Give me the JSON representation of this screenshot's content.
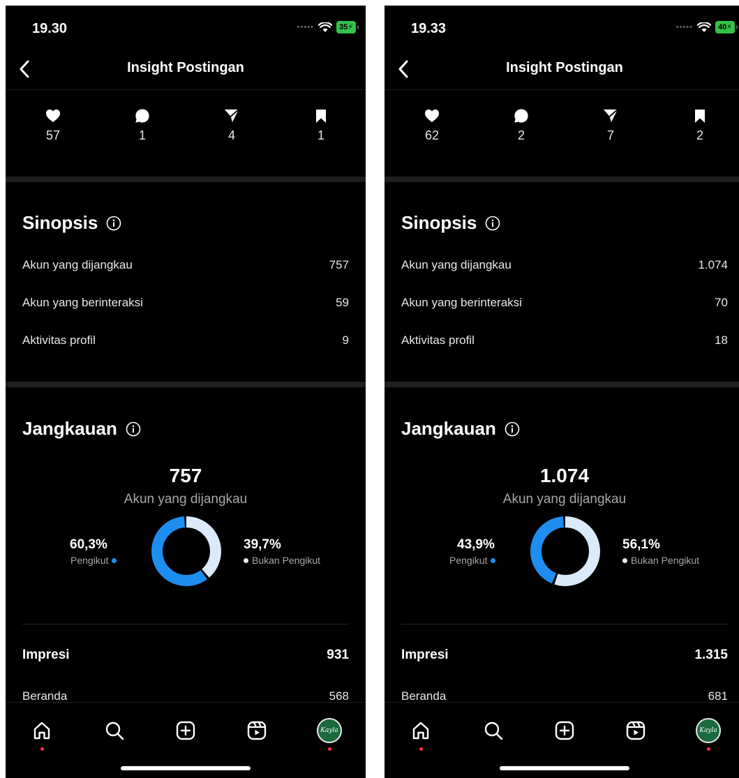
{
  "colors": {
    "follower_blue": "#1d8ef0",
    "non_follower": "#dbeafb",
    "accent_red": "#ff3040",
    "background": "#000000"
  },
  "screens": [
    {
      "status": {
        "time": "19.30",
        "battery": "35"
      },
      "title": "Insight Postingan",
      "metrics": [
        {
          "icon": "heart-icon",
          "value": "57"
        },
        {
          "icon": "comment-icon",
          "value": "1"
        },
        {
          "icon": "share-icon",
          "value": "4"
        },
        {
          "icon": "bookmark-icon",
          "value": "1"
        }
      ],
      "sinopsis": {
        "title": "Sinopsis",
        "rows": [
          {
            "label": "Akun yang dijangkau",
            "value": "757"
          },
          {
            "label": "Akun yang berinteraksi",
            "value": "59"
          },
          {
            "label": "Aktivitas profil",
            "value": "9"
          }
        ]
      },
      "jangkauan": {
        "title": "Jangkauan",
        "total": "757",
        "caption": "Akun yang dijangkau",
        "followers_pct": "60,3%",
        "followers_label": "Pengikut",
        "followers_fraction": 0.603,
        "nonfollowers_pct": "39,7%",
        "nonfollowers_label": "Bukan Pengikut"
      },
      "impresi": {
        "label": "Impresi",
        "value": "931"
      },
      "beranda": {
        "label": "Beranda",
        "value": "568"
      },
      "avatar_text": "Kayla"
    },
    {
      "status": {
        "time": "19.33",
        "battery": "40"
      },
      "title": "Insight Postingan",
      "metrics": [
        {
          "icon": "heart-icon",
          "value": "62"
        },
        {
          "icon": "comment-icon",
          "value": "2"
        },
        {
          "icon": "share-icon",
          "value": "7"
        },
        {
          "icon": "bookmark-icon",
          "value": "2"
        }
      ],
      "sinopsis": {
        "title": "Sinopsis",
        "rows": [
          {
            "label": "Akun yang dijangkau",
            "value": "1.074"
          },
          {
            "label": "Akun yang berinteraksi",
            "value": "70"
          },
          {
            "label": "Aktivitas profil",
            "value": "18"
          }
        ]
      },
      "jangkauan": {
        "title": "Jangkauan",
        "total": "1.074",
        "caption": "Akun yang dijangkau",
        "followers_pct": "43,9%",
        "followers_label": "Pengikut",
        "followers_fraction": 0.439,
        "nonfollowers_pct": "56,1%",
        "nonfollowers_label": "Bukan Pengikut"
      },
      "impresi": {
        "label": "Impresi",
        "value": "1.315"
      },
      "beranda": {
        "label": "Beranda",
        "value": "681"
      },
      "avatar_text": "Kayla"
    }
  ]
}
